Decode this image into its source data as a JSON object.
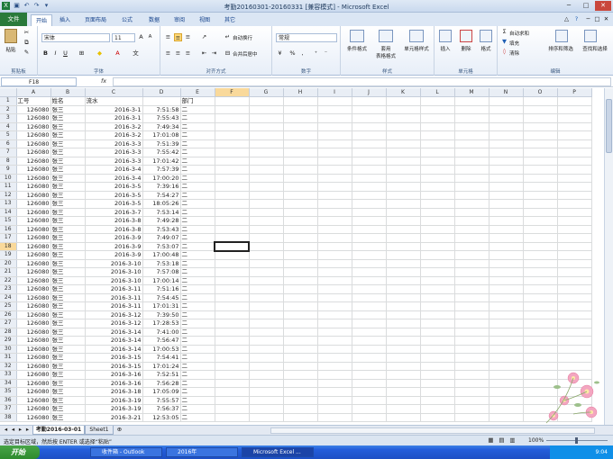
{
  "window": {
    "title": "考勤20160301-20160331  [兼容模式] - Microsoft Excel"
  },
  "ribbon_tabs": [
    "开始",
    "插入",
    "页面布局",
    "公式",
    "数据",
    "审阅",
    "视图",
    "其它"
  ],
  "file_tab": "文件",
  "clipboard": {
    "paste": "粘贴",
    "label": "剪贴板"
  },
  "font": {
    "name": "宋体",
    "size": "11",
    "bold": "B",
    "italic": "I",
    "underline": "U",
    "label": "字体"
  },
  "alignment": {
    "wrap": "自动换行",
    "merge": "合并后居中",
    "label": "对齐方式"
  },
  "number": {
    "format": "常规",
    "percent": "%",
    "comma": ",",
    "label": "数字"
  },
  "styles": {
    "conditional": "条件格式",
    "table": "套用\n表格格式",
    "cell": "单元格样式",
    "label": "样式"
  },
  "cells": {
    "insert": "插入",
    "delete": "删除",
    "format": "格式",
    "label": "单元格"
  },
  "editing": {
    "autosum": "自动求和",
    "fill": "填充",
    "clear": "清除",
    "sort": "排序和筛选",
    "find": "查找和选择",
    "label": "编辑"
  },
  "formula_bar": {
    "name_box": "F18",
    "fx": "fx",
    "value": ""
  },
  "columns": [
    "A",
    "B",
    "C",
    "D",
    "E",
    "F",
    "G",
    "H",
    "I",
    "J",
    "K",
    "L",
    "M",
    "N",
    "O",
    "P"
  ],
  "header_row": [
    "工号",
    "姓名",
    "流水",
    "",
    "部门"
  ],
  "rows": [
    [
      "126080",
      "张三",
      "2016-3-1",
      "7:51:58",
      "二"
    ],
    [
      "126080",
      "张三",
      "2016-3-1",
      "7:55:43",
      "二"
    ],
    [
      "126080",
      "张三",
      "2016-3-2",
      "7:49:34",
      "二"
    ],
    [
      "126080",
      "张三",
      "2016-3-2",
      "17:01:08",
      "二"
    ],
    [
      "126080",
      "张三",
      "2016-3-3",
      "7:51:39",
      "二"
    ],
    [
      "126080",
      "张三",
      "2016-3-3",
      "7:55:42",
      "二"
    ],
    [
      "126080",
      "张三",
      "2016-3-3",
      "17:01:42",
      "二"
    ],
    [
      "126080",
      "张三",
      "2016-3-4",
      "7:57:39",
      "二"
    ],
    [
      "126080",
      "张三",
      "2016-3-4",
      "17:00:20",
      "二"
    ],
    [
      "126080",
      "张三",
      "2016-3-5",
      "7:39:16",
      "二"
    ],
    [
      "126080",
      "张三",
      "2016-3-5",
      "7:54:27",
      "二"
    ],
    [
      "126080",
      "张三",
      "2016-3-5",
      "18:05:26",
      "二"
    ],
    [
      "126080",
      "张三",
      "2016-3-7",
      "7:53:14",
      "二"
    ],
    [
      "126080",
      "张三",
      "2016-3-8",
      "7:49:28",
      "二"
    ],
    [
      "126080",
      "张三",
      "2016-3-8",
      "7:53:43",
      "二"
    ],
    [
      "126080",
      "张三",
      "2016-3-9",
      "7:49:07",
      "二"
    ],
    [
      "126080",
      "张三",
      "2016-3-9",
      "7:53:07",
      "二"
    ],
    [
      "126080",
      "张三",
      "2016-3-9",
      "17:00:48",
      "二"
    ],
    [
      "126080",
      "张三",
      "2016-3-10",
      "7:53:18",
      "二"
    ],
    [
      "126080",
      "张三",
      "2016-3-10",
      "7:57:08",
      "二"
    ],
    [
      "126080",
      "张三",
      "2016-3-10",
      "17:00:14",
      "二"
    ],
    [
      "126080",
      "张三",
      "2016-3-11",
      "7:51:16",
      "二"
    ],
    [
      "126080",
      "张三",
      "2016-3-11",
      "7:54:45",
      "二"
    ],
    [
      "126080",
      "张三",
      "2016-3-11",
      "17:01:31",
      "二"
    ],
    [
      "126080",
      "张三",
      "2016-3-12",
      "7:39:50",
      "二"
    ],
    [
      "126080",
      "张三",
      "2016-3-12",
      "17:28:53",
      "二"
    ],
    [
      "126080",
      "张三",
      "2016-3-14",
      "7:41:00",
      "二"
    ],
    [
      "126080",
      "张三",
      "2016-3-14",
      "7:56:47",
      "二"
    ],
    [
      "126080",
      "张三",
      "2016-3-14",
      "17:00:53",
      "二"
    ],
    [
      "126080",
      "张三",
      "2016-3-15",
      "7:54:41",
      "二"
    ],
    [
      "126080",
      "张三",
      "2016-3-15",
      "17:01:24",
      "二"
    ],
    [
      "126080",
      "张三",
      "2016-3-16",
      "7:52:51",
      "二"
    ],
    [
      "126080",
      "张三",
      "2016-3-16",
      "7:56:28",
      "二"
    ],
    [
      "126080",
      "张三",
      "2016-3-18",
      "17:05:09",
      "二"
    ],
    [
      "126080",
      "张三",
      "2016-3-19",
      "7:55:57",
      "二"
    ],
    [
      "126080",
      "张三",
      "2016-3-19",
      "7:56:37",
      "二"
    ],
    [
      "126080",
      "张三",
      "2016-3-21",
      "12:53:05",
      "二"
    ]
  ],
  "sheets": [
    "考勤2016-03-01",
    "Sheet1"
  ],
  "status": {
    "message": "选定目标区域，然后按 ENTER 或选择“粘贴”",
    "zoom": "100%"
  },
  "taskbar": {
    "start": "开始",
    "items": [
      "收件箱 - Outlook",
      "2016年",
      "Microsoft Excel ..."
    ],
    "time": "9:04"
  }
}
